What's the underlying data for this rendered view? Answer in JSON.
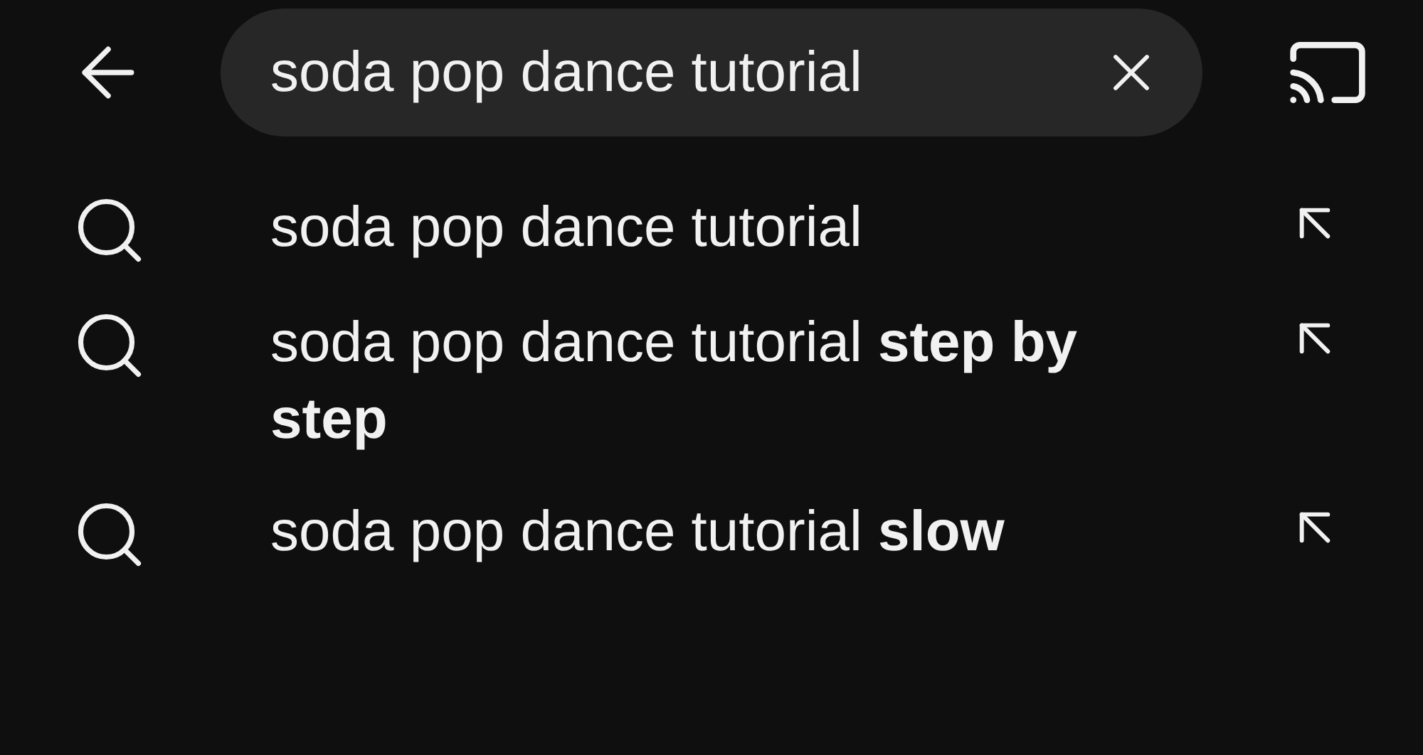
{
  "search": {
    "value": "soda pop dance tutorial"
  },
  "suggestions": [
    {
      "text": "soda pop dance tutorial"
    },
    {
      "text": "soda pop dance tutorial **step by step**"
    },
    {
      "text": "soda pop dance tutorial **slow**"
    }
  ]
}
